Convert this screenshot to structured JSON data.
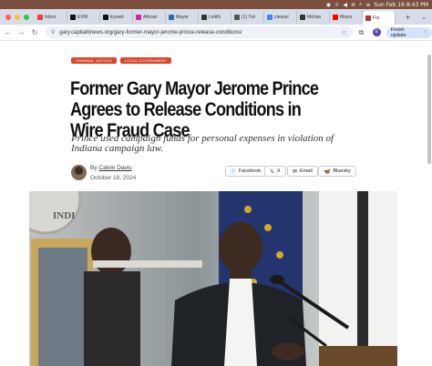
{
  "menubar": {
    "datetime": "Sun Feb 16  8:43 PM"
  },
  "tabs": [
    {
      "label": "Inbox",
      "icon": "gmail-icon",
      "color": "#ea4335"
    },
    {
      "label": "EVW",
      "icon": "x-icon",
      "color": "#111111"
    },
    {
      "label": "Eyewit",
      "icon": "x-icon",
      "color": "#111111"
    },
    {
      "label": "African",
      "icon": "instagram-icon",
      "color": "#d6249f"
    },
    {
      "label": "Mayor",
      "icon": "news-icon",
      "color": "#2b6cb0"
    },
    {
      "label": "LinkN",
      "icon": "wikipedia-icon",
      "color": "#333333"
    },
    {
      "label": "(1) Twi",
      "icon": "page-icon",
      "color": "#555555"
    },
    {
      "label": "cleavel",
      "icon": "google-icon",
      "color": "#4285f4"
    },
    {
      "label": "Mohan",
      "icon": "wikipedia-icon",
      "color": "#333333"
    },
    {
      "label": "Mayor",
      "icon": "youtube-icon",
      "color": "#ff0000"
    },
    {
      "label": "For",
      "icon": "capitalb-icon",
      "color": "#b03a2e",
      "active": true
    }
  ],
  "address_bar": {
    "url": "gary.capitalbnews.org/gary-former-mayor-jerome-prince-release-conditions/",
    "profile_initial": "E",
    "update_label": "Finish update"
  },
  "article": {
    "tags": [
      "CRIMINAL JUSTICE",
      "LOCAL GOVERNMENT"
    ],
    "headline": "Former Gary Mayor Jerome Prince Agrees to Release Conditions in Wire Fraud Case",
    "dek": "Prince used campaign funds for personal expenses in violation of Indiana campaign law.",
    "byline_prefix": "By",
    "author": "Calvin Davis",
    "date": "October 18, 2024",
    "share": {
      "facebook": "Facebook",
      "x": "X",
      "email": "Email",
      "bluesky": "Bluesky"
    },
    "photo_wall_text": "INDI"
  },
  "colors": {
    "accent": "#d9472b",
    "menubar": "#7a4f3e",
    "tabstrip": "#d7dde8"
  }
}
